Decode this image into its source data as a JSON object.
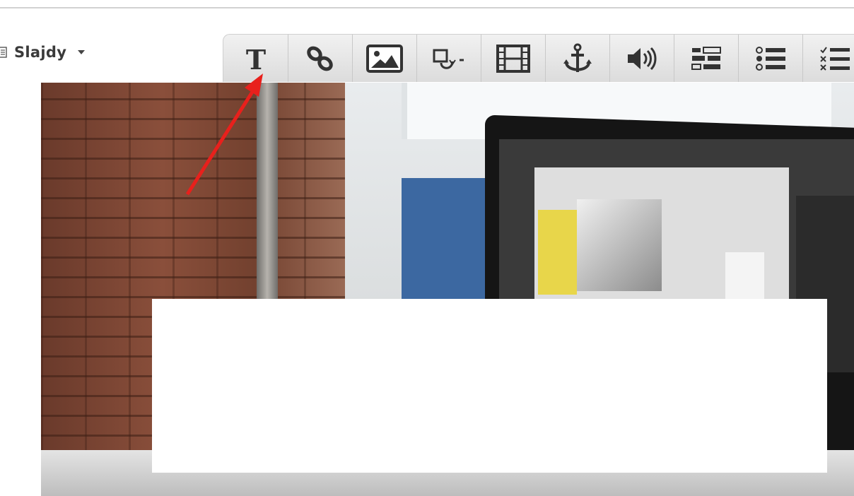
{
  "slides_menu": {
    "label": "Slajdy",
    "icon": "document-icon"
  },
  "toolbar": {
    "tools": [
      {
        "name": "text",
        "icon": "text-t-icon"
      },
      {
        "name": "link",
        "icon": "chain-link-icon"
      },
      {
        "name": "image",
        "icon": "image-icon"
      },
      {
        "name": "shape",
        "icon": "shape-dropdown-icon"
      },
      {
        "name": "video",
        "icon": "film-strip-icon"
      },
      {
        "name": "anchor",
        "icon": "anchor-icon"
      },
      {
        "name": "audio",
        "icon": "speaker-icon"
      },
      {
        "name": "form",
        "icon": "form-fields-icon"
      },
      {
        "name": "list",
        "icon": "bullet-list-icon"
      },
      {
        "name": "checklist",
        "icon": "checklist-icon"
      }
    ],
    "text_glyph": "T"
  },
  "colors": {
    "arrow": "#e8201c",
    "toolbar_bg": "#e6e6e6",
    "icon": "#333333"
  }
}
